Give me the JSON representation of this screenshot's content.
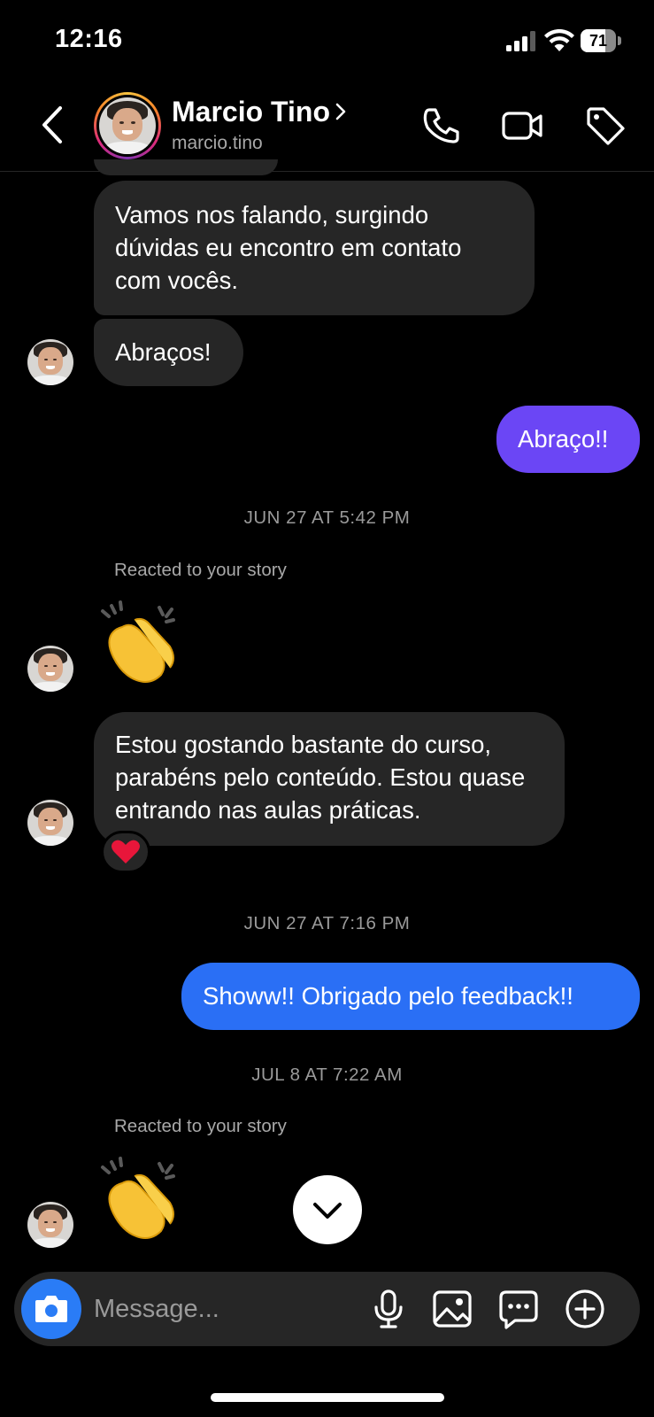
{
  "status_bar": {
    "time": "12:16",
    "battery": "71",
    "battery_level": 0.71
  },
  "header": {
    "name": "Marcio Tino",
    "handle": "marcio.tino"
  },
  "messages": {
    "m1": "Vamos nos falando, surgindo dúvidas eu encontro em contato com vocês.",
    "m2": "Abraços!",
    "m3": "Abraço!!",
    "ts1": "JUN 27 AT 5:42 PM",
    "story1": "Reacted to your story",
    "m4": "Estou gostando bastante do curso, parabéns pelo conteúdo. Estou quase entrando nas aulas práticas.",
    "reaction": "❤️",
    "ts2": "JUN 27 AT 7:16 PM",
    "m5": "Showw!! Obrigado pelo feedback!!",
    "ts3": "JUL 8 AT 7:22 AM",
    "story2": "Reacted to your story"
  },
  "composer": {
    "placeholder": "Message..."
  },
  "colors": {
    "outgoing_purple": "#6b46f5",
    "outgoing_blue": "#2a6ff5",
    "incoming": "#262626",
    "camera": "#2a7cf6"
  },
  "icons": [
    "back-icon",
    "chevron-right-icon",
    "phone-icon",
    "video-icon",
    "tag-icon",
    "clapping-hands-emoji",
    "heart-emoji",
    "chevron-down-icon",
    "camera-icon",
    "microphone-icon",
    "image-icon",
    "sticker-icon",
    "plus-icon"
  ]
}
